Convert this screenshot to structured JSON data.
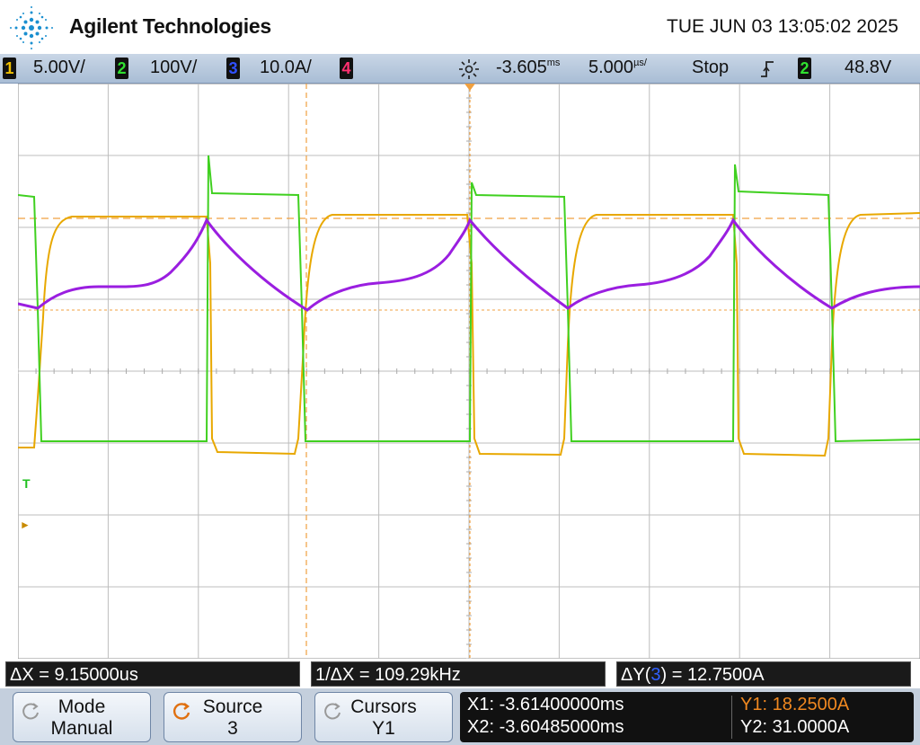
{
  "header": {
    "brand": "Agilent Technologies",
    "datetime": "TUE JUN 03 13:05:02 2025"
  },
  "statusbar": {
    "ch1": {
      "num": "1",
      "scale": "5.00V/",
      "color": "#f0c000"
    },
    "ch2": {
      "num": "2",
      "scale": "100V/",
      "color": "#30e030"
    },
    "ch3": {
      "num": "3",
      "scale": "10.0A/",
      "color": "#3050ff"
    },
    "ch4": {
      "num": "4",
      "color": "#ff3070"
    },
    "delay": "-3.605",
    "delay_unit": "ms",
    "timebase": "5.000",
    "timebase_unit": "µs/",
    "run_state": "Stop",
    "trigger_source": "2",
    "trigger_level": "48.8V"
  },
  "plot": {
    "trigger_marker": "T"
  },
  "measurements": {
    "delta_x": "ΔX = 9.15000us",
    "inv_delta_x": "1/ΔX = 109.29kHz",
    "delta_y_prefix": "ΔY(",
    "delta_y_channel": "3",
    "delta_y_suffix": ") = 12.7500A"
  },
  "softkeys": {
    "mode_label": "Mode",
    "mode_value": "Manual",
    "source_label": "Source",
    "source_value": "3",
    "cursors_label": "Cursors",
    "cursors_value": "Y1"
  },
  "cursor_info": {
    "x1": "X1: -3.61400000ms",
    "x2": "X2: -3.60485000ms",
    "y1": "Y1: 18.2500A",
    "y2": "Y2: 31.0000A"
  },
  "colors": {
    "ch1_trace": "#e8a800",
    "ch2_trace": "#40d020",
    "ch3_trace": "#9a1ee0",
    "cursor_orange": "#f0a040"
  }
}
